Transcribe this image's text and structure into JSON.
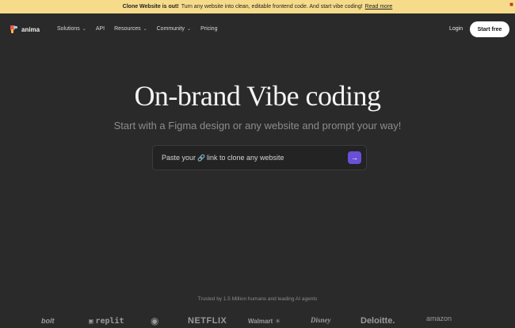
{
  "banner": {
    "bold": "Clone Website is out!",
    "text": "Turn any website into clean, editable frontend code. And start vibe coding!",
    "link": "Read more"
  },
  "nav": {
    "logo_text": "anima",
    "links": [
      "Solutions",
      "API",
      "Resources",
      "Community",
      "Pricing"
    ],
    "login": "Login",
    "start": "Start free"
  },
  "hero": {
    "title": "On-brand Vibe coding",
    "subtitle": "Start with a Figma design or any website and prompt your way!",
    "prompt_before": "Paste your",
    "prompt_after": "link to clone any website"
  },
  "trusted": {
    "text": "Trusted by 1.5 Million humans and leading AI agents",
    "brands": [
      "bolt",
      "replit",
      "apple-icon",
      "NETFLIX",
      "Walmart",
      "Disney",
      "Deloitte.",
      "amazon"
    ]
  },
  "colors": {
    "background": "#2a2a2a",
    "banner": "#f6dc8a",
    "accent": "#6a4fd8"
  }
}
